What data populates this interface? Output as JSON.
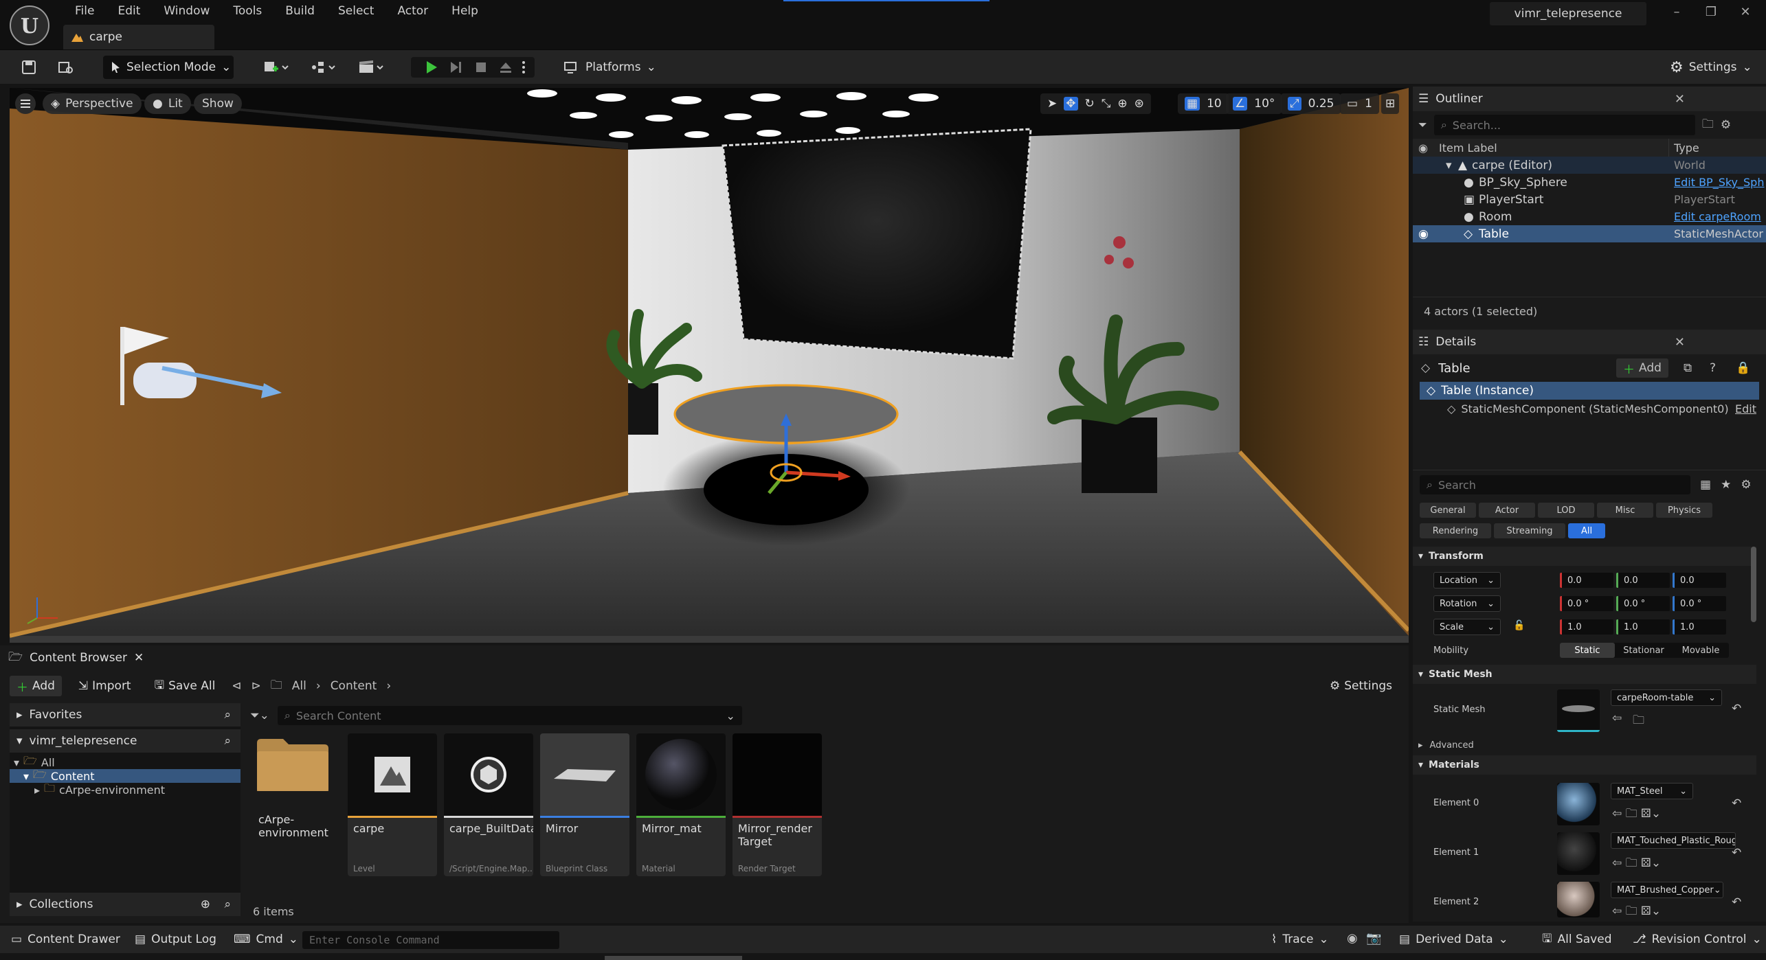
{
  "menu": [
    "File",
    "Edit",
    "Window",
    "Tools",
    "Build",
    "Select",
    "Actor",
    "Help"
  ],
  "level_tab": "carpe",
  "project_name": "vimr_telepresence",
  "toolbar": {
    "selection_mode": "Selection Mode",
    "platforms": "Platforms",
    "settings": "Settings"
  },
  "viewport": {
    "perspective": "Perspective",
    "lit": "Lit",
    "show": "Show",
    "grid_snap": "10",
    "rotation_snap": "10°",
    "scale_snap": "0.25",
    "camera_speed": "1"
  },
  "outliner": {
    "title": "Outliner",
    "search_placeholder": "Search...",
    "col_label": "Item Label",
    "col_type": "Type",
    "rows": [
      {
        "label": "carpe (Editor)",
        "type": "World"
      },
      {
        "label": "BP_Sky_Sphere",
        "type": "Edit BP_Sky_Sph"
      },
      {
        "label": "PlayerStart",
        "type": "PlayerStart"
      },
      {
        "label": "Room",
        "type": "Edit carpeRoom"
      },
      {
        "label": "Table",
        "type": "StaticMeshActor"
      }
    ],
    "status": "4 actors (1 selected)"
  },
  "details": {
    "title": "Details",
    "actor": "Table",
    "add": "Add",
    "instance": "Table (Instance)",
    "component": "StaticMeshComponent (StaticMeshComponent0)",
    "edit": "Edit",
    "search_placeholder": "Search",
    "categories_row1": [
      "General",
      "Actor",
      "LOD",
      "Misc",
      "Physics"
    ],
    "categories_row2": [
      "Rendering",
      "Streaming",
      "All"
    ],
    "transform": {
      "title": "Transform",
      "location": "Location",
      "rotation": "Rotation",
      "scale": "Scale",
      "loc": [
        "0.0",
        "0.0",
        "0.0"
      ],
      "rot": [
        "0.0 °",
        "0.0 °",
        "0.0 °"
      ],
      "scl": [
        "1.0",
        "1.0",
        "1.0"
      ],
      "mobility": "Mobility",
      "mobility_opts": [
        "Static",
        "Stationar",
        "Movable"
      ]
    },
    "static_mesh": {
      "title": "Static Mesh",
      "label": "Static Mesh",
      "value": "carpeRoom-table",
      "advanced": "Advanced"
    },
    "materials": {
      "title": "Materials",
      "elements": [
        {
          "label": "Element 0",
          "value": "MAT_Steel"
        },
        {
          "label": "Element 1",
          "value": "MAT_Touched_Plastic_Roug"
        },
        {
          "label": "Element 2",
          "value": "MAT_Brushed_Copper"
        }
      ]
    }
  },
  "content_browser": {
    "title": "Content Browser",
    "add": "Add",
    "import": "Import",
    "save_all": "Save All",
    "path": [
      "All",
      "Content"
    ],
    "settings": "Settings",
    "favorites": "Favorites",
    "project": "vimr_telepresence",
    "tree": [
      "All",
      "Content",
      "cArpe-environment"
    ],
    "collections": "Collections",
    "search_placeholder": "Search Content",
    "item_count": "6 items",
    "assets": [
      {
        "name": "cArpe-\nenvironment",
        "type": ""
      },
      {
        "name": "carpe",
        "type": "Level"
      },
      {
        "name": "carpe_BuiltData",
        "type": "/Script/Engine.Map..."
      },
      {
        "name": "Mirror",
        "type": "Blueprint Class"
      },
      {
        "name": "Mirror_mat",
        "type": "Material"
      },
      {
        "name": "Mirror_render\nTarget",
        "type": "Render Target"
      }
    ]
  },
  "statusbar": {
    "content_drawer": "Content Drawer",
    "output_log": "Output Log",
    "cmd": "Cmd",
    "console_placeholder": "Enter Console Command",
    "trace": "Trace",
    "derived_data": "Derived Data",
    "all_saved": "All Saved",
    "revision_control": "Revision Control"
  }
}
